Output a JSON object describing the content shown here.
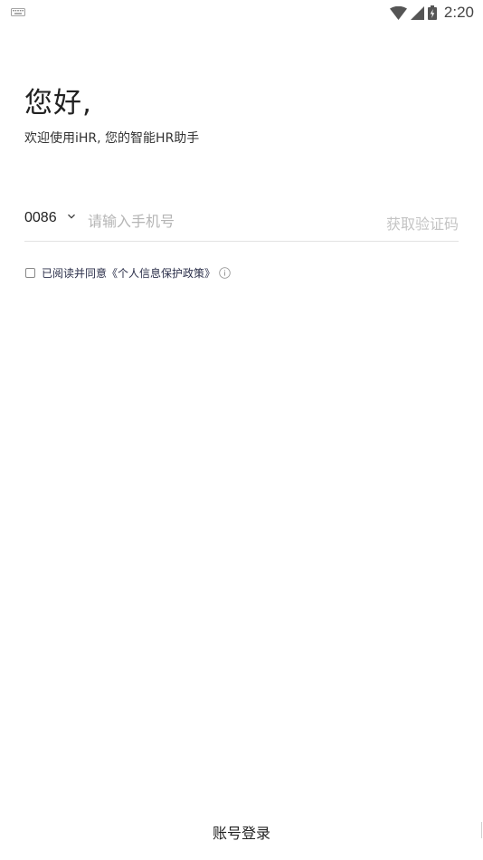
{
  "status_bar": {
    "time": "2:20",
    "icons": [
      "keyboard-icon",
      "wifi-icon",
      "signal-icon",
      "battery-charging-icon"
    ]
  },
  "greeting": {
    "title": "您好,",
    "subtitle": "欢迎使用iHR, 您的智能HR助手"
  },
  "login_form": {
    "country_code": "0086",
    "phone_placeholder": "请输入手机号",
    "phone_value": "",
    "get_code_label": "获取验证码"
  },
  "agreement": {
    "checked": false,
    "text": "已阅读并同意《个人信息保护政策》"
  },
  "footer": {
    "account_login_label": "账号登录"
  },
  "colors": {
    "text_primary": "#222222",
    "placeholder": "#b5b5b5",
    "disabled": "#c4c4c4",
    "divider": "#e2e2e2",
    "agreement_text": "#2b2f4a"
  }
}
